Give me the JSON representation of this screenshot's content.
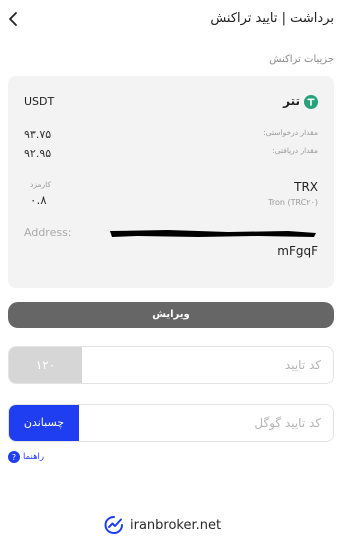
{
  "header": {
    "title": "برداشت | تایید تراکنش"
  },
  "details": {
    "section_label": "جزییات تراکنش",
    "currency_code": "USDT",
    "currency_name": "تتر",
    "requested_label": "مقدار درخواستی:",
    "requested_value": "۹۳.۷۵",
    "received_label": "مقدار دریافتی:",
    "received_value": "۹۲.۹۵",
    "fee_label": "کارمزد",
    "fee_value": "۰.۸",
    "network_symbol": "TRX",
    "network_name": "Tron (TRC۲۰)",
    "address_label": "Address:",
    "address_tail": "mFgqF"
  },
  "actions": {
    "edit_label": "ویرایش",
    "confirm_code_placeholder": "کد تایید",
    "resend_counter": "۱۲۰",
    "google_code_placeholder": "کد تایید گوگل",
    "paste_label": "چسباندن",
    "guide_label": "راهنما"
  },
  "footer": {
    "brand": "iranbroker.net"
  },
  "colors": {
    "accent_blue": "#1f3ef2",
    "tether_green": "#27a17a",
    "edit_button": "#666666",
    "card_bg": "#f3f3f3"
  }
}
